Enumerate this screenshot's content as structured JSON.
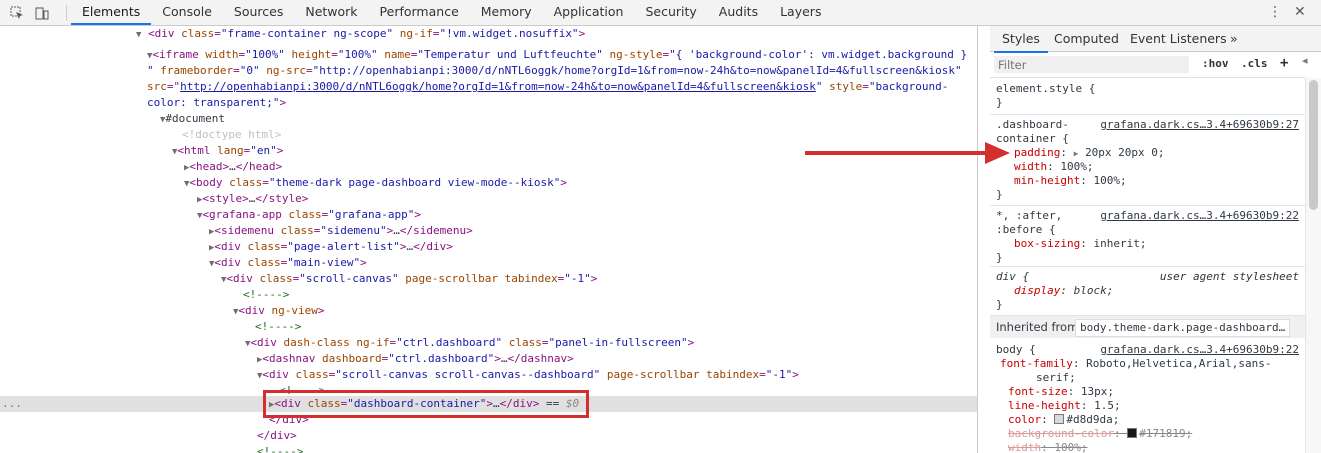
{
  "toolbar": {
    "tabs": [
      "Elements",
      "Console",
      "Sources",
      "Network",
      "Performance",
      "Memory",
      "Application",
      "Security",
      "Audits",
      "Layers"
    ],
    "active_tab": "Elements",
    "inspect_icon": "inspect-element-icon",
    "device_icon": "device-toggle-icon",
    "more_icon": "more-vertical-icon",
    "close_icon": "close-icon"
  },
  "elements": {
    "lines": [
      {
        "t": "<div class=\"frame-container ng-scope\" ng-if=\"!vm.widget.nosuffix\">"
      },
      {
        "t": "<iframe width=\"100%\" height=\"100%\" name=\"Temperatur und Luftfeuchte\" ng-style=\"{ 'background-color': vm.widget.background }"
      },
      {
        "t": "\" frameborder=\"0\" ng-src=\"http://openhabianpi:3000/d/nNTL6oggk/home?orgId=1&from=now-24h&to=now&panelId=4&fullscreen&kiosk\""
      },
      {
        "t_prefix": "src=\"",
        "link": "http://openhabianpi:3000/d/nNTL6oggk/home?orgId=1&from=now-24h&to=now&panelId=4&fullscreen&kiosk",
        "t_suffix": "\" style=\"background-"
      },
      {
        "t": "color: transparent;\">"
      },
      {
        "t": "#document"
      },
      {
        "t": "<!doctype html>"
      },
      {
        "t": "<html lang=\"en\">"
      },
      {
        "t": "<head>…</head>"
      },
      {
        "t": "<body class=\"theme-dark page-dashboard view-mode--kiosk\">"
      },
      {
        "t": "<style>…</style>"
      },
      {
        "t": "<grafana-app class=\"grafana-app\">"
      },
      {
        "t": "<sidemenu class=\"sidemenu\">…</sidemenu>"
      },
      {
        "t": "<div class=\"page-alert-list\">…</div>"
      },
      {
        "t": "<div class=\"main-view\">"
      },
      {
        "t": "<div class=\"scroll-canvas\" page-scrollbar tabindex=\"-1\">"
      },
      {
        "t": "<!---->"
      },
      {
        "t": "<div ng-view>"
      },
      {
        "t": "<!---->"
      },
      {
        "t": "<div dash-class ng-if=\"ctrl.dashboard\" class=\"panel-in-fullscreen\">"
      },
      {
        "t": "<dashnav dashboard=\"ctrl.dashboard\">…</dashnav>"
      },
      {
        "t": "<div class=\"scroll-canvas scroll-canvas--dashboard\" page-scrollbar tabindex=\"-1\">"
      },
      {
        "t": "<!---->"
      },
      {
        "t": "<div class=\"dashboard-container\">…</div> == $0"
      },
      {
        "t": "</div>"
      },
      {
        "t": "</div>"
      },
      {
        "t": "<!---->"
      }
    ],
    "selected_dots": "..."
  },
  "styles": {
    "tabs": [
      "Styles",
      "Computed",
      "Event Listeners"
    ],
    "more_tabs": "»",
    "filter_placeholder": "Filter",
    "hov": ":hov",
    "cls": ".cls",
    "add": "+",
    "element_style": {
      "selector": "element.style {",
      "close": "}"
    },
    "rule1": {
      "selector1": ".dashboard-",
      "selector2": "container {",
      "source": "grafana.dark.cs…3.4+69630b9:27",
      "props": [
        [
          "padding",
          "20px 20px 0;"
        ],
        [
          "width",
          "100%;"
        ],
        [
          "min-height",
          "100%;"
        ]
      ],
      "close": "}"
    },
    "rule2": {
      "selector1": "*, :after,",
      "selector2": ":before {",
      "source": "grafana.dark.cs…3.4+69630b9:22",
      "props": [
        [
          "box-sizing",
          "inherit;"
        ]
      ],
      "close": "}"
    },
    "rule3": {
      "selector": "div {",
      "source": "user agent stylesheet",
      "props": [
        [
          "display",
          "block;"
        ]
      ],
      "close": "}"
    },
    "inherited_label": "Inherited from",
    "inherited_selector": "body.theme-dark.page-dashboard…",
    "rule4": {
      "selector": "body {",
      "source": "grafana.dark.cs…3.4+69630b9:22",
      "ff_name": "font-family",
      "ff_val1": "Roboto,Helvetica,Arial,sans-",
      "ff_val2": "serif;",
      "fs_name": "font-size",
      "fs_val": "13px;",
      "lh_name": "line-height",
      "lh_val": "1.5;",
      "c_name": "color",
      "c_val": "#d8d9da;",
      "bg_name": "background-color",
      "bg_val": "#171819;",
      "w_name": "width",
      "w_val": "100%;"
    },
    "colors": {
      "color_swatch": "#d8d9da",
      "bg_swatch": "#171819"
    }
  }
}
